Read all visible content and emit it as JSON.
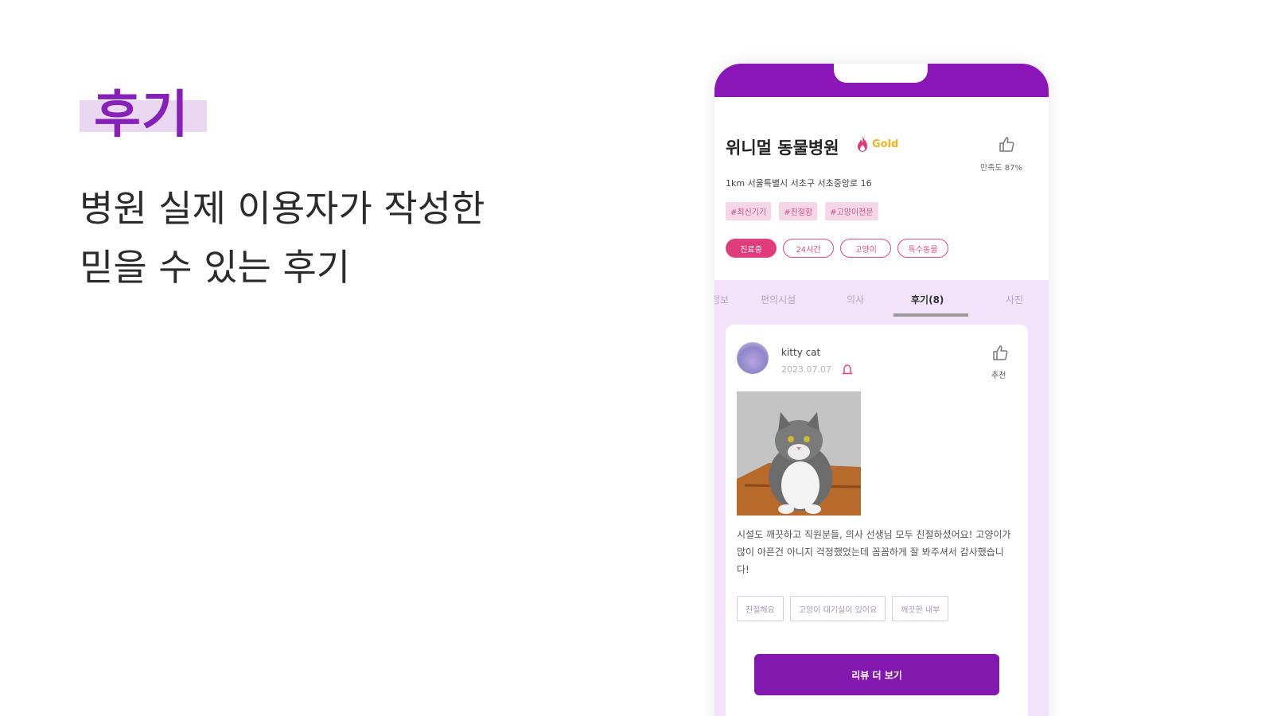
{
  "promo": {
    "title": "후기",
    "desc_line1": "병원 실제 이용자가 작성한",
    "desc_line2": "믿을 수 있는 후기"
  },
  "hospital": {
    "name": "위니멀 동물병원",
    "grade": "Gold",
    "satisfaction": "만족도 87%",
    "address": "1km   서울특별시 서초구 서초중앙로 16",
    "tags": [
      "#최신기기",
      "#친절함",
      "#고양이전문"
    ],
    "chips": [
      "진료중",
      "24시간",
      "고양이",
      "특수동물"
    ]
  },
  "tabs": [
    "정보",
    "편의시설",
    "의사",
    "후기(8)",
    "사진"
  ],
  "active_tab": "후기(8)",
  "review": {
    "user": "kitty cat",
    "date": "2023.07.07",
    "recommend_label": "추천",
    "text": "시설도 깨끗하고 직원분들, 의사 선생님 모두 친절하셨어요! 고양이가 많이 아픈건 아니지 걱정했었는데 꼼꼼하게 잘 봐주셔서 감사했습니다!",
    "keywords": [
      "친절해요",
      "고양이 대기실이 있어요",
      "깨끗한 내부"
    ],
    "more_button": "리뷰 더 보기"
  },
  "colors": {
    "brand_purple": "#8b16b8",
    "pink": "#df3c7c",
    "gold": "#f2b21b",
    "lavender": "#f0e3fa"
  },
  "icons": [
    "fire-icon",
    "thumbs-up-icon",
    "report-icon",
    "avatar"
  ]
}
